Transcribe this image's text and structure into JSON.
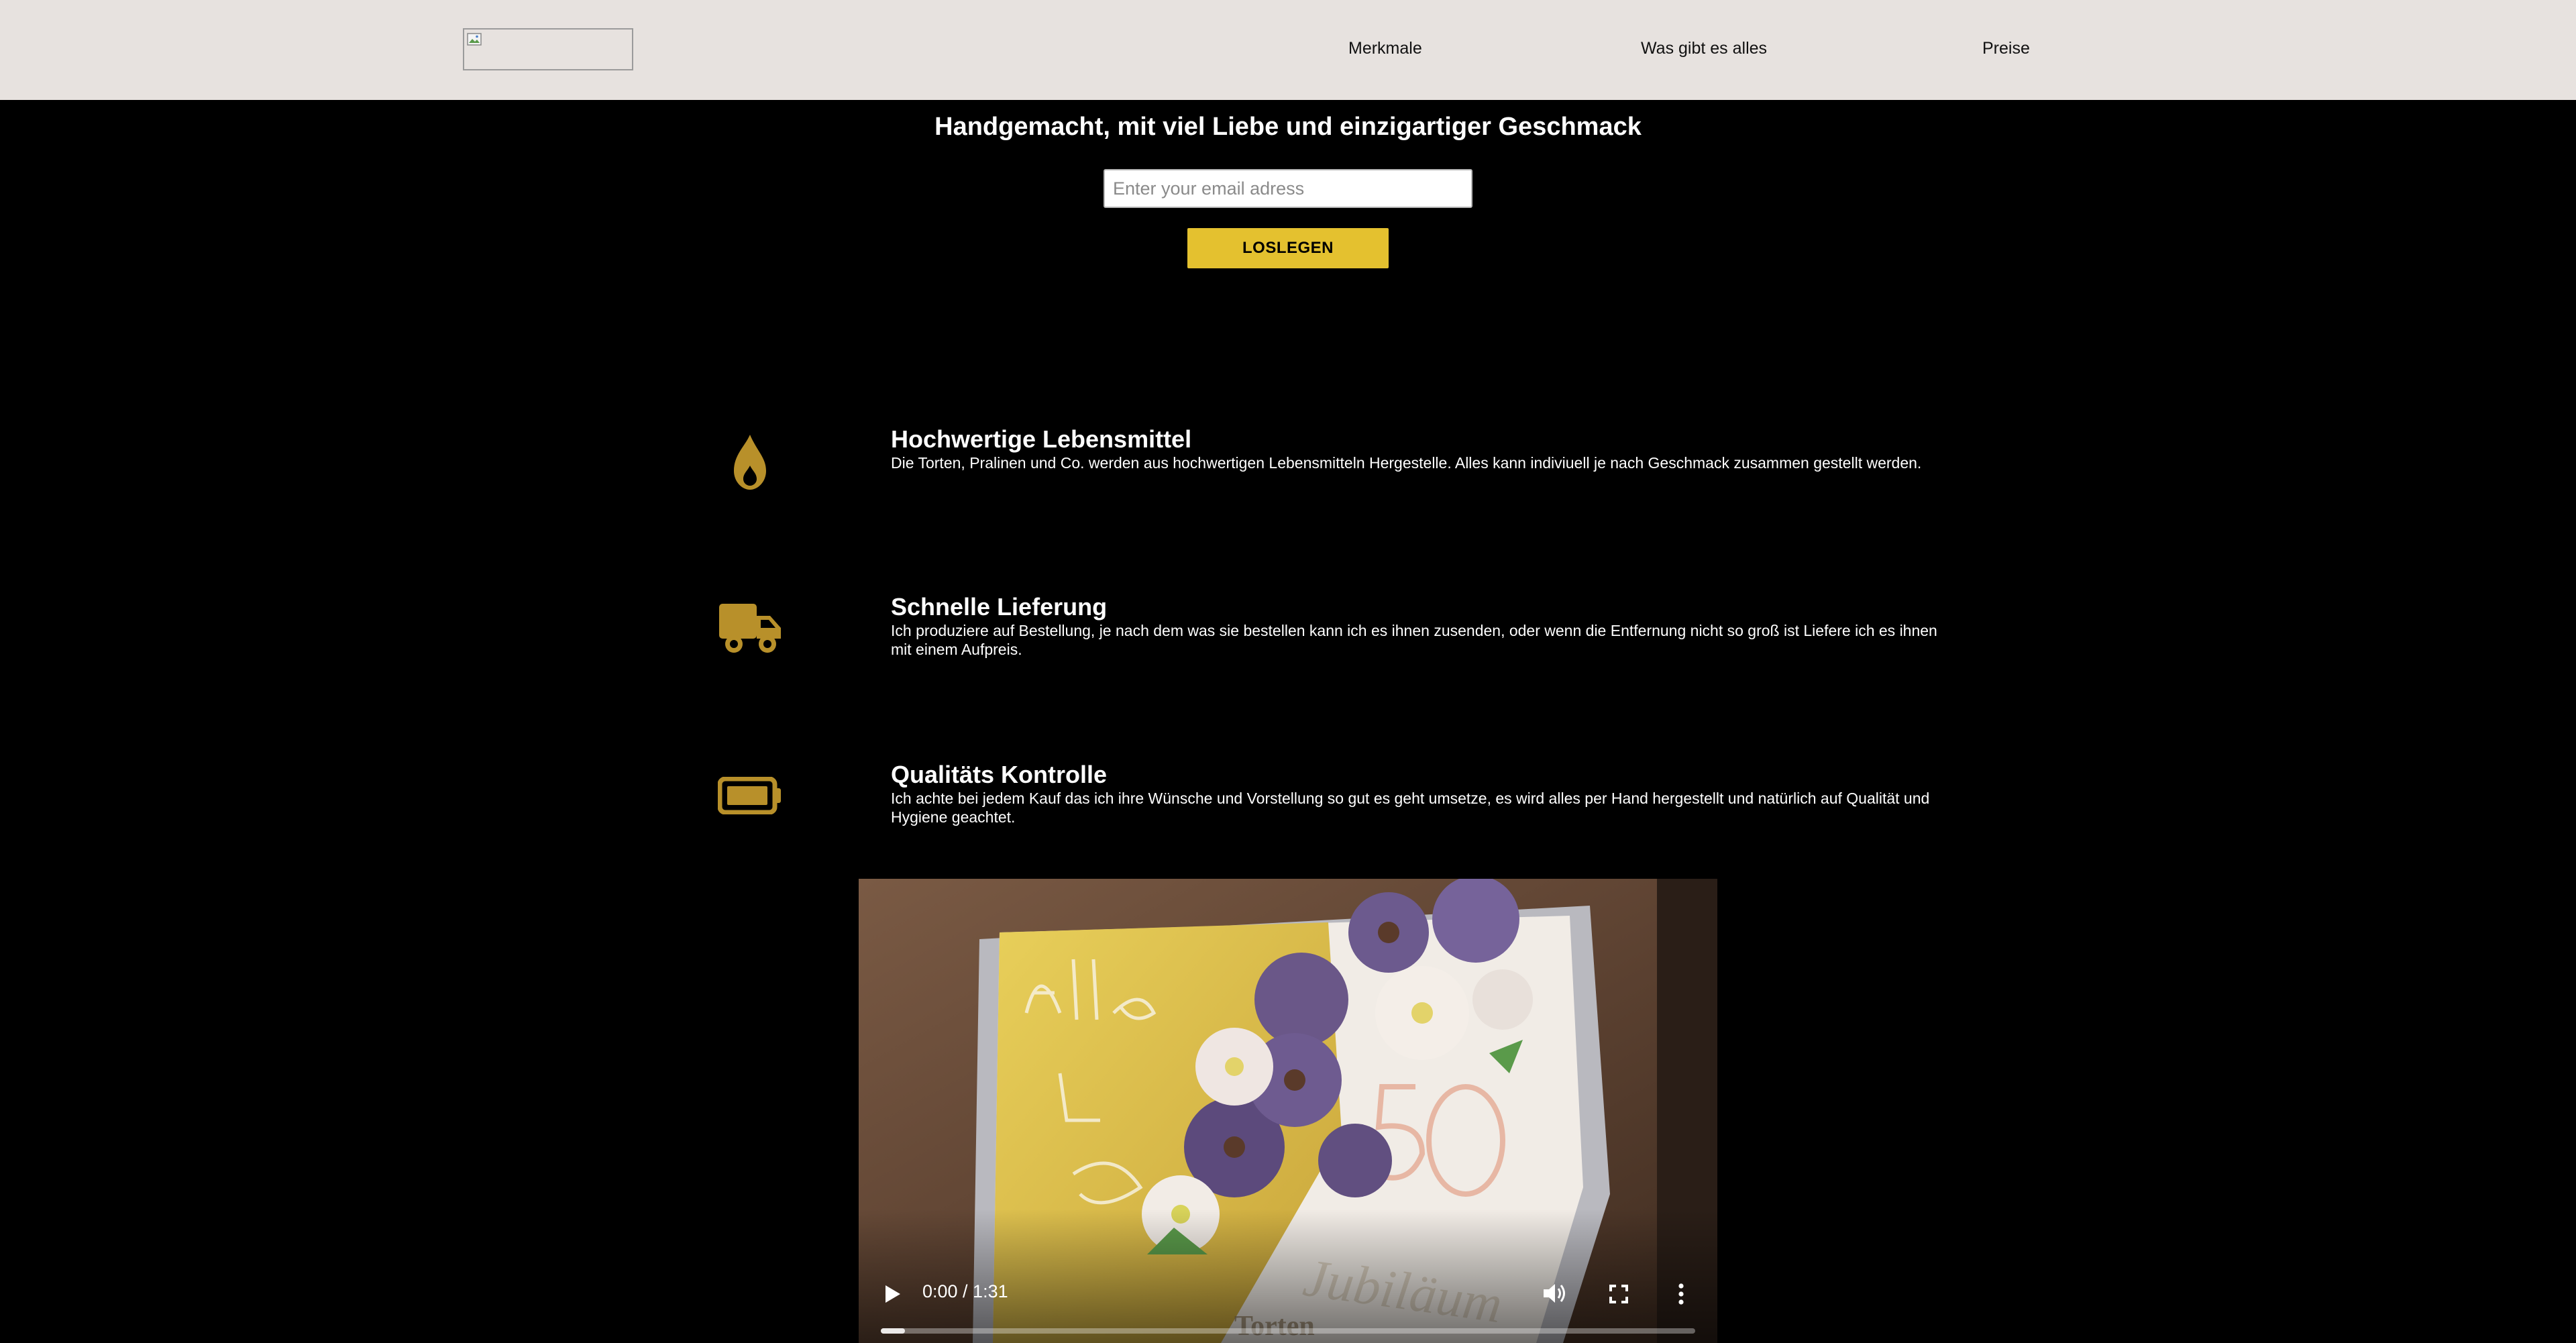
{
  "header": {
    "logo_icon": "broken-image-icon",
    "nav": [
      "Merkmale",
      "Was gibt es alles",
      "Preise"
    ]
  },
  "hero": {
    "title": "Handgemacht, mit viel Liebe und einzigartiger Geschmack",
    "email_placeholder": "Enter your email adress",
    "email_value": "",
    "button_label": "LOSLEGEN"
  },
  "features": [
    {
      "icon": "flame-icon",
      "title": "Hochwertige Lebensmittel",
      "text": "Die Torten, Pralinen und Co. werden aus hochwertigen Lebensmitteln Hergestelle. Alles kann indiviuell je nach Geschmack zusammen gestellt werden."
    },
    {
      "icon": "truck-icon",
      "title": "Schnelle Lieferung",
      "text": "Ich produziere auf Bestellung, je nach dem was sie bestellen kann ich es ihnen zusenden, oder wenn die Entfernung nicht so groß ist Liefere ich es ihnen mit einem Aufpreis."
    },
    {
      "icon": "battery-icon",
      "title": "Qualitäts Kontrolle",
      "text": "Ich achte bei jedem Kauf das ich ihre Wünsche und Vorstellung so gut es geht umsetze, es wird alles per Hand hergestellt und natürlich auf Qualität und Hygiene geachtet."
    }
  ],
  "video": {
    "time": "0:00 / 1:31",
    "progress": 0,
    "controls": [
      "play-icon",
      "volume-icon",
      "fullscreen-icon",
      "more-options-icon"
    ]
  },
  "colors": {
    "header_bg": "#e7e2df",
    "page_bg": "#000000",
    "accent": "#e4c12f",
    "icon_gold": "#b8902a"
  }
}
